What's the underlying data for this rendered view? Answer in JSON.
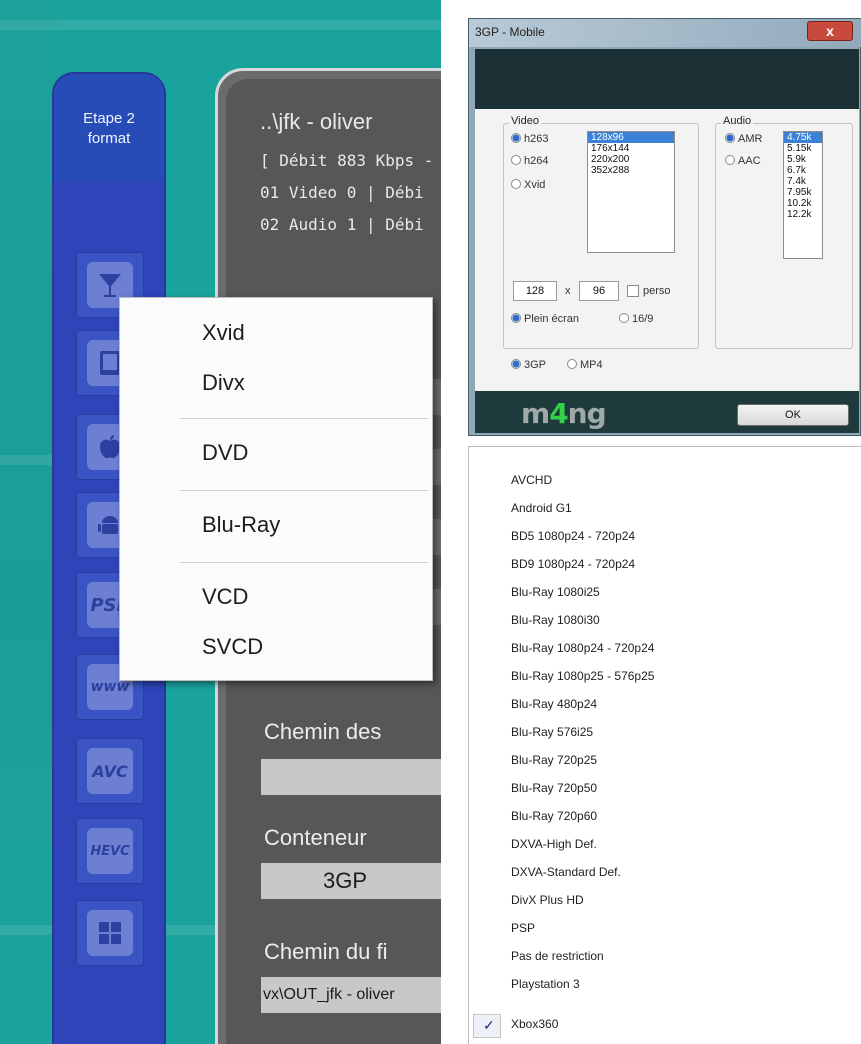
{
  "left": {
    "rail": {
      "title_line1": "Etape 2",
      "title_line2": "format"
    },
    "rail_icons": [
      {
        "name": "cocktail-icon",
        "text": ""
      },
      {
        "name": "tablet-icon",
        "text": ""
      },
      {
        "name": "apple-icon",
        "text": ""
      },
      {
        "name": "android-icon",
        "text": ""
      },
      {
        "name": "psp-icon",
        "text": "PSP"
      },
      {
        "name": "www-icon",
        "text": "www"
      },
      {
        "name": "avc-icon",
        "text": "AVC"
      },
      {
        "name": "hevc-icon",
        "text": "HEVC"
      },
      {
        "name": "windows-icon",
        "text": ""
      }
    ],
    "panel": {
      "filename": "..\\jfk - oliver",
      "info1": "[ Débit 883 Kbps -",
      "info2": "01 Video 0 | Débi",
      "info3": "02 Audio 1 | Débi",
      "chemin_des_label": "Chemin des",
      "conteneur_label": "Conteneur",
      "conteneur_value": "3GP",
      "chemin_du_label": "Chemin du fi",
      "chemin_du_value": "vx\\OUT_jfk - oliver"
    },
    "context_menu": {
      "items": [
        "Xvid",
        "Divx",
        "DVD",
        "Blu-Ray",
        "VCD",
        "SVCD"
      ]
    }
  },
  "dialog": {
    "title": "3GP - Mobile",
    "close_label": "x",
    "video_group": "Video",
    "video_codecs": [
      "h263",
      "h264",
      "Xvid"
    ],
    "video_sizes": [
      "128x96",
      "176x144",
      "220x200",
      "352x288"
    ],
    "width_value": "128",
    "by": "x",
    "height_value": "96",
    "perso_label": "perso",
    "plein_ecran_label": "Plein écran",
    "ratio_label": "16/9",
    "format_3gp": "3GP",
    "format_mp4": "MP4",
    "audio_group": "Audio",
    "audio_codecs": [
      "AMR",
      "AAC"
    ],
    "audio_rates": [
      "4.75k",
      "5.15k",
      "5.9k",
      "6.7k",
      "7.4k",
      "7.95k",
      "10.2k",
      "12.2k"
    ],
    "logo_left": "m",
    "logo_four": "4",
    "logo_right": "ng",
    "ok_label": "OK"
  },
  "profiles": {
    "items": [
      "AVCHD",
      "Android G1",
      "BD5 1080p24 - 720p24",
      "BD9 1080p24 - 720p24",
      "Blu-Ray 1080i25",
      "Blu-Ray 1080i30",
      "Blu-Ray 1080p24 - 720p24",
      "Blu-Ray 1080p25 - 576p25",
      "Blu-Ray 480p24",
      "Blu-Ray 576i25",
      "Blu-Ray 720p25",
      "Blu-Ray 720p50",
      "Blu-Ray 720p60",
      "DXVA-High Def.",
      "DXVA-Standard Def.",
      "DivX Plus HD",
      "PSP",
      "Pas de restriction",
      "Playstation 3",
      "Xbox360"
    ],
    "checked_mark": "✓"
  },
  "colors": {
    "teal": "#1aa39c",
    "rail_blue": "#2f44b8",
    "panel_grey": "#575757",
    "dialog_dark": "#1a3034",
    "select_blue": "#3b82d6"
  }
}
